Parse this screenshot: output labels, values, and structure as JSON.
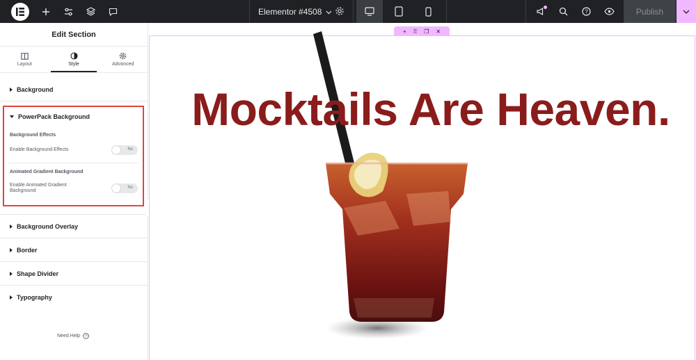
{
  "topbar": {
    "document_title": "Elementor #4508",
    "publish_label": "Publish",
    "left_icons": [
      "add-icon",
      "settings-sliders-icon",
      "layers-icon",
      "comments-icon"
    ],
    "devices": [
      "desktop-icon",
      "tablet-icon",
      "mobile-icon"
    ],
    "active_device": "desktop",
    "right_icons": [
      "whats-new-icon",
      "search-icon",
      "help-icon",
      "preview-eye-icon"
    ],
    "accent": "#f1b8ff"
  },
  "panel": {
    "title": "Edit Section",
    "tabs": [
      {
        "label": "Layout",
        "icon": "columns-icon"
      },
      {
        "label": "Style",
        "icon": "contrast-icon"
      },
      {
        "label": "Advanced",
        "icon": "gear-icon"
      }
    ],
    "active_tab": "Style",
    "sections_top": [
      "Background"
    ],
    "powerpack": {
      "title": "PowerPack Background",
      "effects_heading": "Background Effects",
      "effects_label": "Enable Background Effects",
      "effects_value": "No",
      "gradient_heading": "Animated Gradient Background",
      "gradient_label_line1": "Enable Animated Gradient",
      "gradient_label_line2": "Background",
      "gradient_value": "No",
      "highlight_color": "#e0443e"
    },
    "sections_bottom": [
      "Background Overlay",
      "Border",
      "Shape Divider",
      "Typography"
    ],
    "need_help": "Need Help"
  },
  "canvas": {
    "headline": "Mocktails Are Heaven.",
    "headline_color": "#8a1c1c",
    "section_handle_icons": [
      "plus-icon",
      "drag-grid-icon",
      "duplicate-icon",
      "close-icon"
    ],
    "section_handle_glyphs": [
      "+",
      "⠿",
      "❐",
      "✕"
    ]
  }
}
